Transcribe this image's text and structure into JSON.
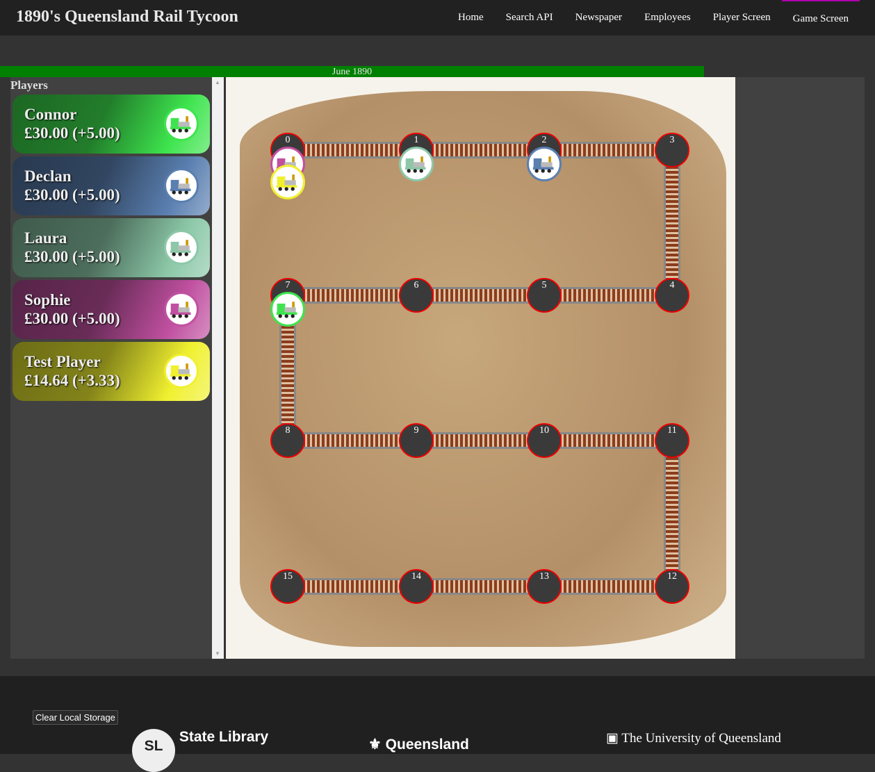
{
  "header": {
    "title": "1890's Queensland Rail Tycoon",
    "nav": [
      "Home",
      "Search API",
      "Newspaper",
      "Employees",
      "Player Screen",
      "Game Screen"
    ],
    "active": "Game Screen"
  },
  "date": "June 1890",
  "sidebar": {
    "heading": "Players",
    "players": [
      {
        "name": "Connor",
        "money": "£30.00 (+5.00)",
        "color": "#3ee44e",
        "node": 7
      },
      {
        "name": "Declan",
        "money": "£30.00 (+5.00)",
        "color": "#5a7fb0",
        "node": 2
      },
      {
        "name": "Laura",
        "money": "£30.00 (+5.00)",
        "color": "#8cc8a8",
        "node": 1
      },
      {
        "name": "Sophie",
        "money": "£30.00 (+5.00)",
        "color": "#c050a0",
        "node": 0
      },
      {
        "name": "Test Player",
        "money": "£14.64 (+3.33)",
        "color": "#f0f030",
        "node": 0
      }
    ]
  },
  "board": {
    "nodes": [
      "0",
      "1",
      "2",
      "3",
      "4",
      "5",
      "6",
      "7",
      "8",
      "9",
      "10",
      "11",
      "12",
      "13",
      "14",
      "15"
    ],
    "tracks": [
      [
        0,
        1
      ],
      [
        1,
        2
      ],
      [
        2,
        3
      ],
      [
        3,
        4
      ],
      [
        4,
        5
      ],
      [
        5,
        6
      ],
      [
        6,
        7
      ],
      [
        7,
        8
      ],
      [
        8,
        9
      ],
      [
        9,
        10
      ],
      [
        10,
        11
      ],
      [
        11,
        12
      ],
      [
        12,
        13
      ],
      [
        13,
        14
      ],
      [
        14,
        15
      ]
    ]
  },
  "footer": {
    "clear_button": "Clear Local Storage",
    "logos": [
      "State Library",
      "Queensland",
      "The University of Queensland"
    ]
  }
}
